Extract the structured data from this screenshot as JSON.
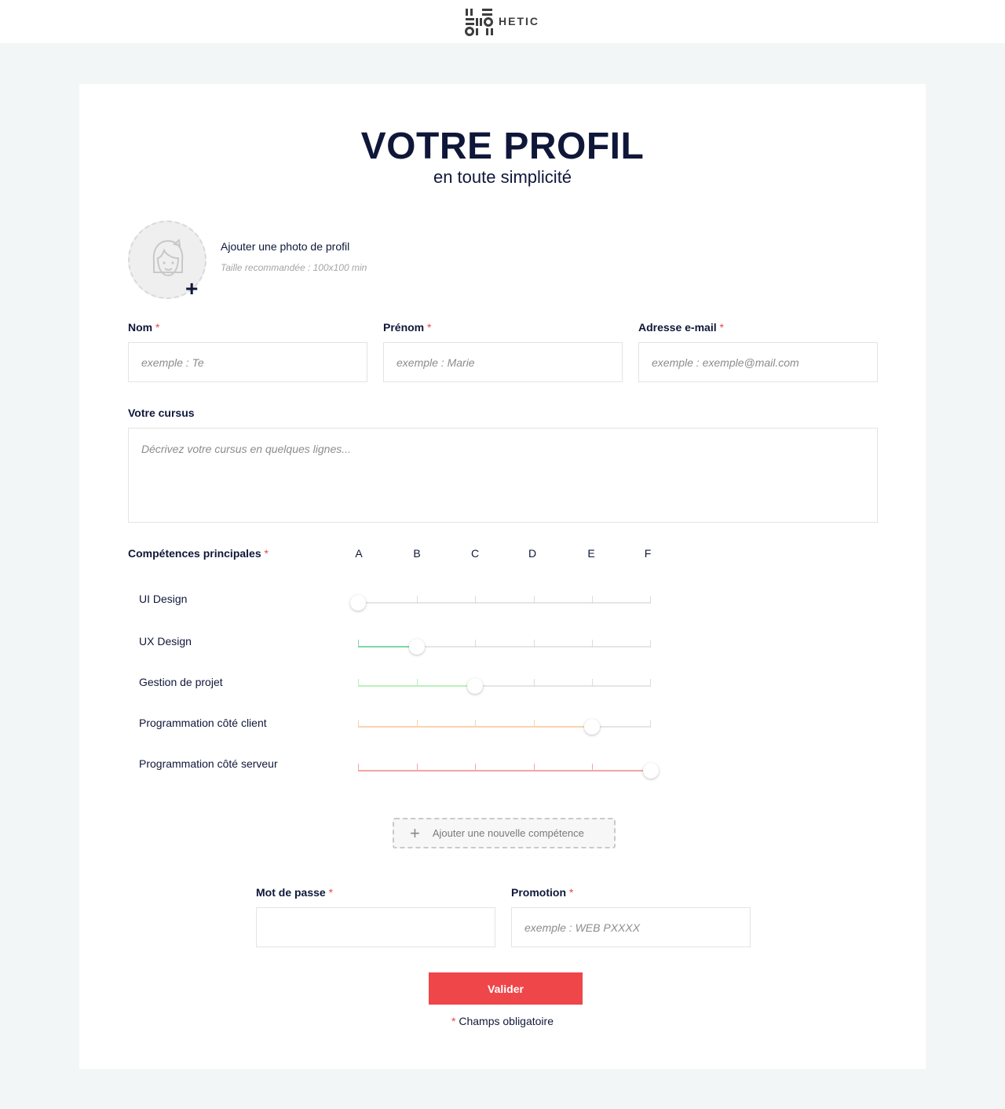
{
  "header": {
    "brand": "HETIC"
  },
  "page": {
    "title": "VOTRE PROFIL",
    "subtitle": "en toute simplicité"
  },
  "photo": {
    "label": "Ajouter une photo de profil",
    "hint": "Taille recommandée : 100x100 min"
  },
  "required_mark": "*",
  "fields": {
    "nom": {
      "label": "Nom",
      "placeholder": "exemple : Te"
    },
    "prenom": {
      "label": "Prénom",
      "placeholder": "exemple : Marie"
    },
    "email": {
      "label": "Adresse e-mail",
      "placeholder": "exemple : exemple@mail.com"
    },
    "cursus": {
      "label": "Votre cursus",
      "placeholder": "Décrivez votre cursus en quelques lignes..."
    },
    "password": {
      "label": "Mot de passe",
      "placeholder": ""
    },
    "promotion": {
      "label": "Promotion",
      "placeholder": "exemple : WEB PXXXX"
    }
  },
  "skills": {
    "label": "Compétences principales",
    "grades": [
      "A",
      "B",
      "C",
      "D",
      "E",
      "F"
    ],
    "items": [
      {
        "name": "UI Design",
        "level": "A",
        "color": "#e5e5e5"
      },
      {
        "name": "UX Design",
        "level": "B",
        "color": "#7fd8a8"
      },
      {
        "name": "Gestion de projet",
        "level": "C",
        "color": "#b9f0bd"
      },
      {
        "name": "Programmation côté client",
        "level": "E",
        "color": "#f8d4b0"
      },
      {
        "name": "Programmation côté serveur",
        "level": "F",
        "color": "#f2a6a3"
      }
    ],
    "add_label": "Ajouter une nouvelle compétence"
  },
  "submit_label": "Valider",
  "footnote": "Champs obligatoire",
  "colors": {
    "accent": "#ef464a",
    "navy": "#0f1739"
  }
}
